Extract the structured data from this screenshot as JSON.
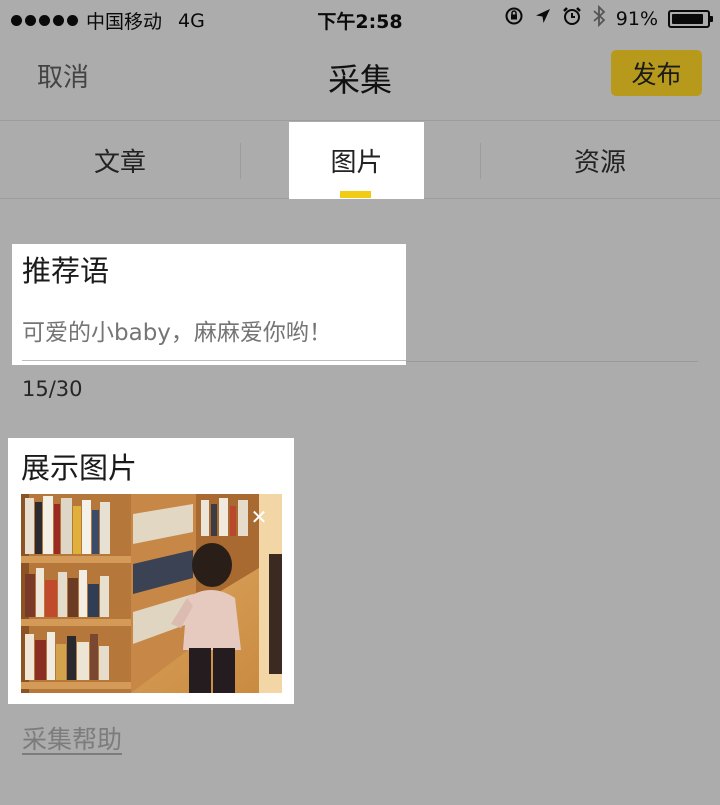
{
  "status_bar": {
    "carrier": "中国移动",
    "network": "4G",
    "time": "下午2:58",
    "battery": "91%",
    "battery_level": 0.91
  },
  "nav": {
    "cancel": "取消",
    "title": "采集",
    "publish": "发布",
    "publish_color": "#b79a1c"
  },
  "tabs": [
    {
      "label": "文章",
      "active": false
    },
    {
      "label": "图片",
      "active": true
    },
    {
      "label": "资源",
      "active": false
    }
  ],
  "accent_color": "#f2cc14",
  "recommend": {
    "title": "推荐语",
    "value": "",
    "placeholder": "可爱的小baby，麻麻爱你哟！",
    "count": "15/30"
  },
  "images": {
    "title": "展示图片",
    "close_icon": "close-icon",
    "photo": "child-at-bookshelf-photo"
  },
  "help": "采集帮助"
}
